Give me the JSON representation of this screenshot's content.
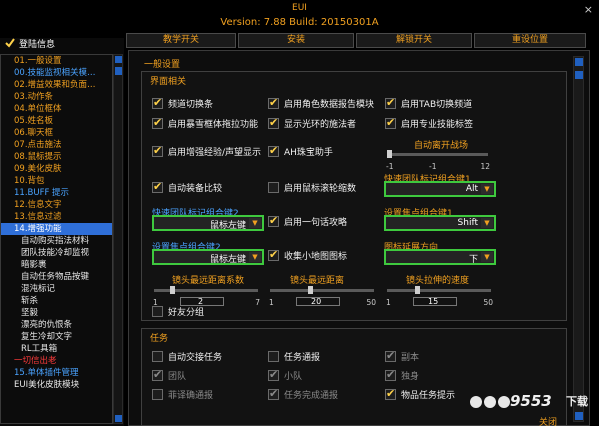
{
  "window": {
    "title": "EUI",
    "version": "Version: 7.88 Build: 20150301A",
    "close": "×"
  },
  "tabs": [
    "教学开关",
    "安装",
    "解锁开关",
    "重设位置"
  ],
  "tree": {
    "root_label": "登陆信息",
    "items": [
      {
        "label": "01.一般设置",
        "color": "orange"
      },
      {
        "label": "00.技能监视相关模…",
        "color": "blue"
      },
      {
        "label": "02.增益效果和负面…",
        "color": "orange"
      },
      {
        "label": "03.动作条",
        "color": "orange"
      },
      {
        "label": "04.单位框体",
        "color": "orange"
      },
      {
        "label": "05.姓名板",
        "color": "orange"
      },
      {
        "label": "06.聊天框",
        "color": "orange"
      },
      {
        "label": "07.点击施法",
        "color": "orange"
      },
      {
        "label": "08.鼠标提示",
        "color": "orange"
      },
      {
        "label": "09.美化皮肤",
        "color": "orange"
      },
      {
        "label": "10.背包",
        "color": "orange"
      },
      {
        "label": "11.BUFF 提示",
        "color": "blue"
      },
      {
        "label": "12.信息文字",
        "color": "orange"
      },
      {
        "label": "13.信息过滤",
        "color": "orange"
      },
      {
        "label": "14.增强功能",
        "color": "selected"
      },
      {
        "label": "自动购买指法材料",
        "color": "sub"
      },
      {
        "label": "团队技能冷却监视",
        "color": "sub"
      },
      {
        "label": "暗影裹",
        "color": "sub"
      },
      {
        "label": "自动任务物品按键",
        "color": "sub"
      },
      {
        "label": "混沌标记",
        "color": "sub"
      },
      {
        "label": "斩杀",
        "color": "sub"
      },
      {
        "label": "坚毅",
        "color": "sub"
      },
      {
        "label": "漂亮的仇恨条",
        "color": "sub"
      },
      {
        "label": "复生冷却文字",
        "color": "sub"
      },
      {
        "label": "RL工具箱",
        "color": "sub"
      },
      {
        "label": "一切信出老",
        "color": "red"
      },
      {
        "label": "15.单体插件管理",
        "color": "blue"
      },
      {
        "label": "EUI美化皮肤模块",
        "color": "white"
      }
    ]
  },
  "main": {
    "heading": "一般设置",
    "interface_group": {
      "title": "界面相关",
      "checkboxes": [
        {
          "label": "频道切换条",
          "checked": true
        },
        {
          "label": "启用角色数据报告模块",
          "checked": true
        },
        {
          "label": "启用TAB切换频道",
          "checked": true
        },
        {
          "label": "启用暴雪框体拖拉功能",
          "checked": true
        },
        {
          "label": "显示光环的施法者",
          "checked": true
        },
        {
          "label": "启用专业技能标签",
          "checked": true
        },
        {
          "label": "启用增强经验/声望显示",
          "checked": true
        },
        {
          "label": "AH珠宝助手",
          "checked": true
        },
        {
          "label": "自动装备比较",
          "checked": true
        },
        {
          "label": "启用鼠标滚轮缩数",
          "checked": false
        },
        {
          "label": "启用一句话攻略",
          "checked": true
        },
        {
          "label": "收集小地图图标",
          "checked": true
        },
        {
          "label": "好友分组",
          "checked": false
        }
      ],
      "auto_leave": {
        "label": "自动离开战场",
        "min": "-1",
        "max": "12",
        "value": "-1"
      },
      "quick_mark": {
        "label": "快速团队标记组合键1",
        "value": "Alt"
      },
      "quick_mark2": {
        "label": "快速团队标记组合键2",
        "value": "鼠标左键"
      },
      "focus_mod": {
        "label": "设置焦点组合键1",
        "value": "Shift"
      },
      "focus_key": {
        "label": "设置焦点组合键2",
        "value": "鼠标左键"
      },
      "icon_dir": {
        "label": "图标延展方向",
        "value": "下"
      },
      "sliders": [
        {
          "label": "镜头最远距离系数",
          "min": "1",
          "max": "7",
          "value": "2"
        },
        {
          "label": "镜头最远距离",
          "min": "1",
          "max": "50",
          "value": "20"
        },
        {
          "label": "镜头拉伸的速度",
          "min": "1",
          "max": "50",
          "value": "15"
        }
      ]
    },
    "quest_group": {
      "title": "任务",
      "checkboxes": [
        {
          "label": "自动交接任务",
          "state": "empty"
        },
        {
          "label": "任务通报",
          "state": "empty"
        },
        {
          "label": "副本",
          "state": "dim"
        },
        {
          "label": "团队",
          "state": "dim"
        },
        {
          "label": "小队",
          "state": "dim"
        },
        {
          "label": "独身",
          "state": "dim"
        },
        {
          "label": "菲译确通报",
          "state": "dimempty"
        },
        {
          "label": "任务完成通报",
          "state": "dim"
        },
        {
          "label": "物品任务提示",
          "state": "checked"
        }
      ]
    },
    "close_label": "关闭"
  },
  "watermark": {
    "brand": "9553",
    "suffix": "下载"
  }
}
